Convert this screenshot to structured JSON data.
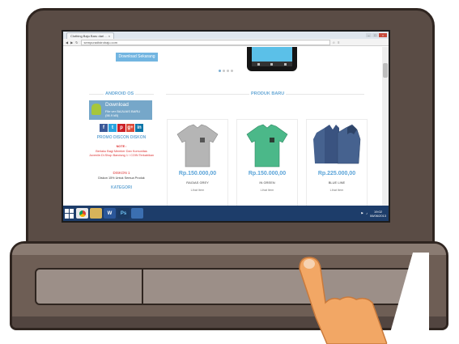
{
  "browser": {
    "tab_title": "Clothing Baju Baru dari ...",
    "tab_close": "×",
    "url": "sempuradistrobaju.com",
    "win_min": "–",
    "win_max": "□",
    "win_close": "×"
  },
  "page": {
    "download_now_button": "Download Sekarang",
    "android_heading": "ANDROID OS",
    "android_box": {
      "title": "Download",
      "line1": "File ver BAJUAIS BARU",
      "line2": "(56.9 kB)"
    },
    "social_icons": [
      "f",
      "t",
      "p",
      "g+",
      "in"
    ],
    "promo_heading": "PROMO DISCON DISKON",
    "note_label": "NOTE :",
    "note_text": "Berlaku Bagi Member Dan Komunitas Juvenile.Di.Shop Bandung 1 / COIN Terkabikan",
    "discount_heading": "DISKON 1",
    "discount_text": "Diskon 15% Untuk Semua Produk",
    "category_heading": "KATEGORI",
    "new_products_heading": "PRODUK BARU",
    "products": [
      {
        "price": "Rp.150.000,00",
        "name": "RAGIAS GREY",
        "action": "Lihat Item",
        "color": "#b5b5b5"
      },
      {
        "price": "Rp.150.000,00",
        "name": "IN GREEN",
        "action": "Lihat Item",
        "color": "#4bb889"
      },
      {
        "price": "Rp.225.000,00",
        "name": "BLUE LINE",
        "action": "Lihat Item",
        "color": "#46628f"
      }
    ]
  },
  "taskbar": {
    "apps": [
      "chrome",
      "explorer",
      "word",
      "photoshop",
      "windows"
    ],
    "time": "19:02",
    "date": "06/06/2013"
  },
  "colors": {
    "laptop_body": "#5a4c45",
    "accent_blue": "#6aa9d6",
    "taskbar": "#1d3d6a"
  }
}
